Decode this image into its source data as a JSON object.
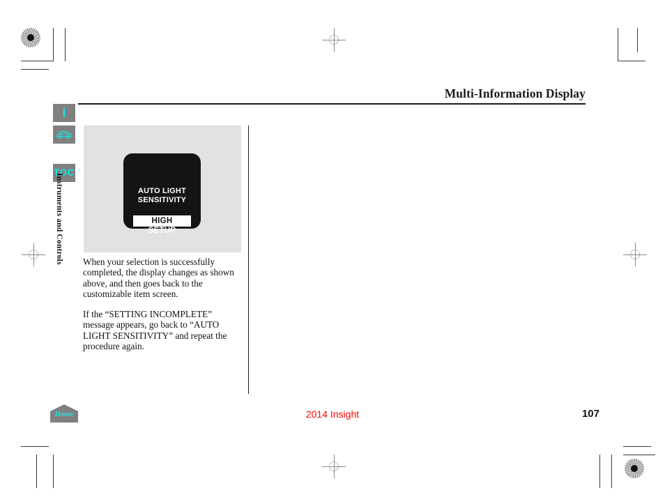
{
  "header": {
    "title": "Multi-Information Display"
  },
  "sidebar": {
    "items": [
      {
        "name": "info-icon",
        "label": "i",
        "icon": "info-icon"
      },
      {
        "name": "vehicle-icon",
        "label": "",
        "icon": "car-icon"
      },
      {
        "name": "toc-icon",
        "label": "TOC",
        "icon": "toc-icon"
      }
    ],
    "section_label": "Instruments and Controls"
  },
  "figure": {
    "display": {
      "title_line1": "AUTO LIGHT",
      "title_line2": "SENSITIVITY",
      "selected_value": "HIGH",
      "footer_label": "SETUP"
    }
  },
  "body": {
    "paragraphs": [
      "When your selection is successfully completed, the display changes as shown above, and then goes back to the customizable item screen.",
      "If the “SETTING INCOMPLETE” message appears, go back to “AUTO LIGHT SENSITIVITY” and repeat the procedure again."
    ]
  },
  "footer": {
    "home_label": "Home",
    "model": "2014 Insight",
    "page_number": "107"
  },
  "colors": {
    "accent_cyan": "#16e3e3",
    "icon_gray": "#808080",
    "panel_gray": "#e2e2e2",
    "model_red": "#ff0000",
    "display_black": "#141414"
  }
}
